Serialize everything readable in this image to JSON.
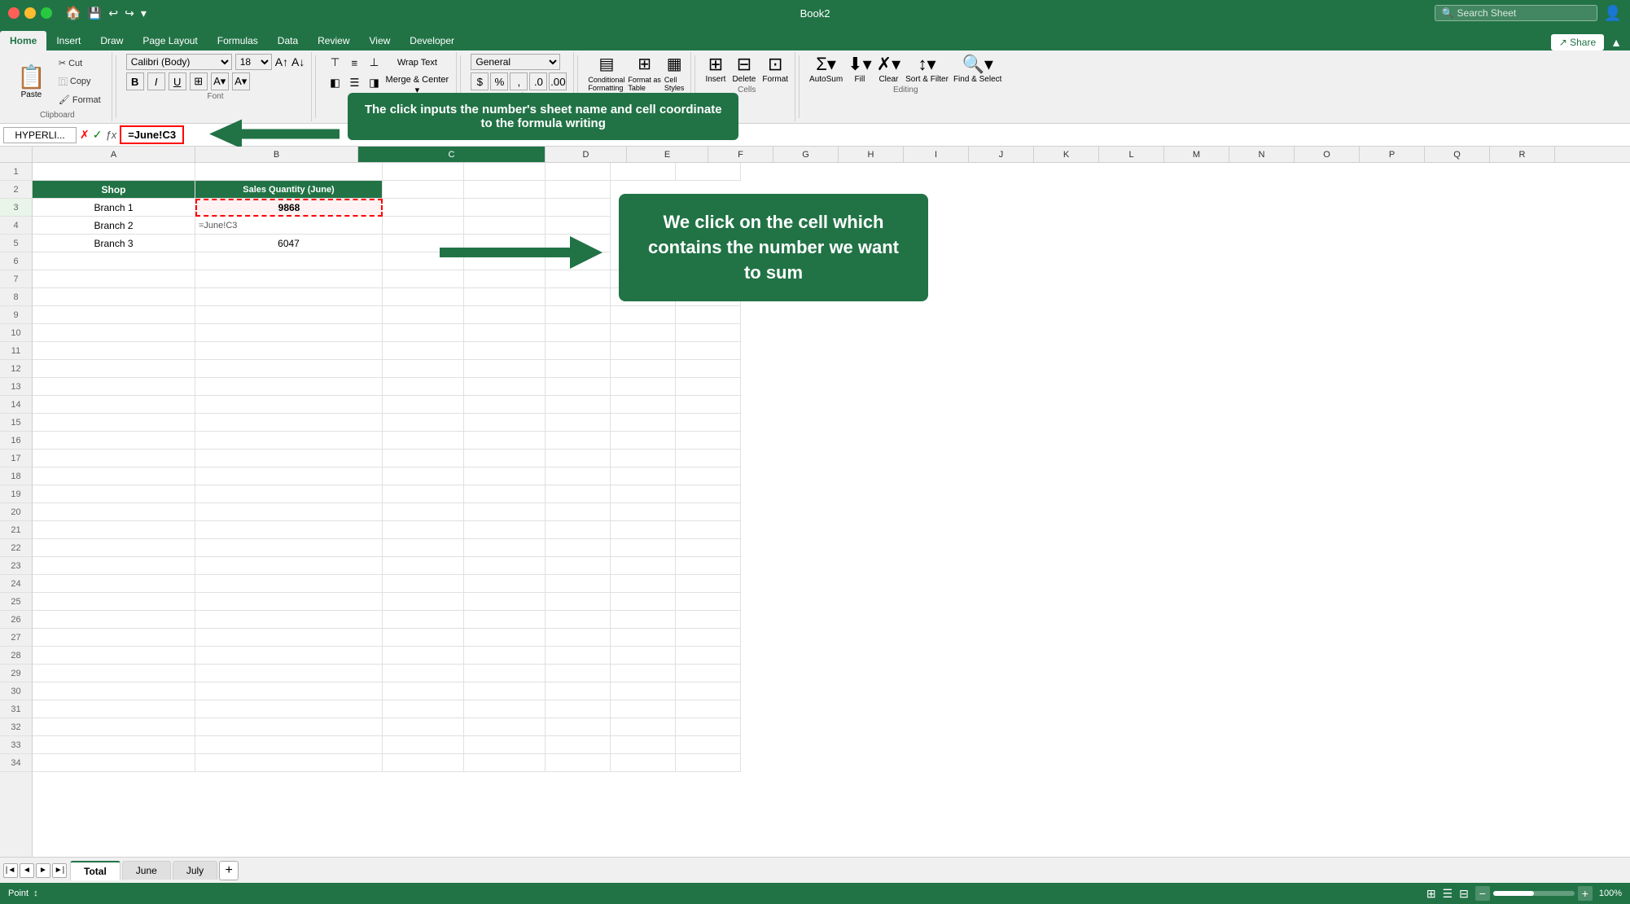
{
  "app": {
    "title": "Book2",
    "search_placeholder": "Search Sheet"
  },
  "window_controls": {
    "close": "×",
    "minimize": "–",
    "maximize": "+"
  },
  "tabs": {
    "items": [
      "Home",
      "Insert",
      "Draw",
      "Page Layout",
      "Formulas",
      "Data",
      "Review",
      "View",
      "Developer"
    ],
    "active": "Home"
  },
  "ribbon": {
    "paste_label": "Paste",
    "clipboard_label": "Clipboard",
    "cut_label": "Cut",
    "copy_label": "Copy",
    "format_painter_label": "Format",
    "font_name": "Calibri (Body)",
    "font_size": "18",
    "bold": "B",
    "italic": "I",
    "underline": "U",
    "wrap_text": "Wrap Text",
    "number_format": "General",
    "autosum_label": "AutoSum",
    "fill_label": "Fill",
    "clear_label": "Clear",
    "sort_filter_label": "Sort & Filter",
    "find_select_label": "Find & Select",
    "insert_label": "Insert",
    "delete_label": "Delete",
    "format_label": "Format",
    "share_label": "Share"
  },
  "formula_bar": {
    "name_box": "HYPERLI...",
    "formula_value": "=June!C3"
  },
  "columns": [
    "A",
    "B",
    "C",
    "D",
    "E",
    "F",
    "G",
    "H",
    "I",
    "J",
    "K",
    "L",
    "M",
    "N",
    "O",
    "P",
    "Q",
    "R"
  ],
  "rows": [
    "1",
    "2",
    "3",
    "4",
    "5",
    "6",
    "7",
    "8",
    "9",
    "10",
    "11",
    "12",
    "13",
    "14",
    "15",
    "16",
    "17",
    "18",
    "19",
    "20",
    "21",
    "22",
    "23",
    "24",
    "25",
    "26",
    "27",
    "28",
    "29",
    "30",
    "31",
    "32",
    "33",
    "34"
  ],
  "table": {
    "header_shop": "Shop",
    "header_sales": "Sales Quantity (June)",
    "branch1": "Branch 1",
    "branch2": "Branch 2",
    "branch3": "Branch 3",
    "value1": "9868",
    "value2": "=June!C3",
    "value3": "6047"
  },
  "tooltips": {
    "formula_tooltip": "The click inputs the number's sheet name and cell coordinate to the formula writing",
    "cell_tooltip": "We click on the cell which contains the number we want to sum"
  },
  "sheet_tabs": {
    "tabs": [
      "Total",
      "June",
      "July"
    ],
    "active": "Total",
    "add_label": "+"
  },
  "status_bar": {
    "mode": "Point",
    "icon": "↕",
    "zoom": "100%",
    "zoom_minus": "−",
    "zoom_plus": "+"
  }
}
